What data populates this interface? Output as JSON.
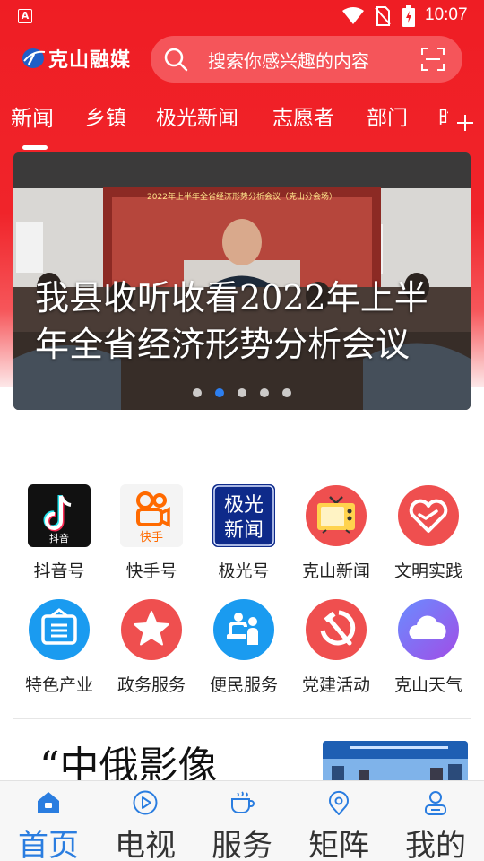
{
  "status_bar": {
    "app_badge": "A",
    "time": "10:07"
  },
  "header": {
    "logo_text": "克山融媒",
    "search_placeholder": "搜索你感兴趣的内容"
  },
  "tabs": [
    "新闻",
    "乡镇",
    "极光新闻",
    "志愿者",
    "部门",
    "时"
  ],
  "banner": {
    "headline": "我县收听收看2022年上半年全省经济形势分析会议",
    "screen_caption": "2022年上半年全省经济形势分析会议（克山分会场）",
    "page_count": 5,
    "active_page": 2
  },
  "shortcuts": [
    {
      "label": "抖音号",
      "icon": "douyin-icon",
      "icon_text": "抖音"
    },
    {
      "label": "快手号",
      "icon": "kuaishou-icon",
      "icon_text": "快手"
    },
    {
      "label": "极光号",
      "icon": "jiguang-news-icon",
      "icon_text": "极光新闻"
    },
    {
      "label": "克山新闻",
      "icon": "tv-icon"
    },
    {
      "label": "文明实践",
      "icon": "heart-icon"
    },
    {
      "label": "特色产业",
      "icon": "signboard-icon"
    },
    {
      "label": "政务服务",
      "icon": "star-icon"
    },
    {
      "label": "便民服务",
      "icon": "people-service-icon"
    },
    {
      "label": "党建活动",
      "icon": "party-emblem-icon"
    },
    {
      "label": "克山天气",
      "icon": "cloud-icon"
    }
  ],
  "article": {
    "title": "“中俄影像"
  },
  "bottom_nav": [
    {
      "label": "首页",
      "icon": "home-icon",
      "active": true
    },
    {
      "label": "电视",
      "icon": "play-icon",
      "active": false
    },
    {
      "label": "服务",
      "icon": "cup-icon",
      "active": false
    },
    {
      "label": "矩阵",
      "icon": "location-icon",
      "active": false
    },
    {
      "label": "我的",
      "icon": "user-icon",
      "active": false
    }
  ],
  "colors": {
    "brand_red": "#ef1d24",
    "active_blue": "#2a7de0"
  }
}
